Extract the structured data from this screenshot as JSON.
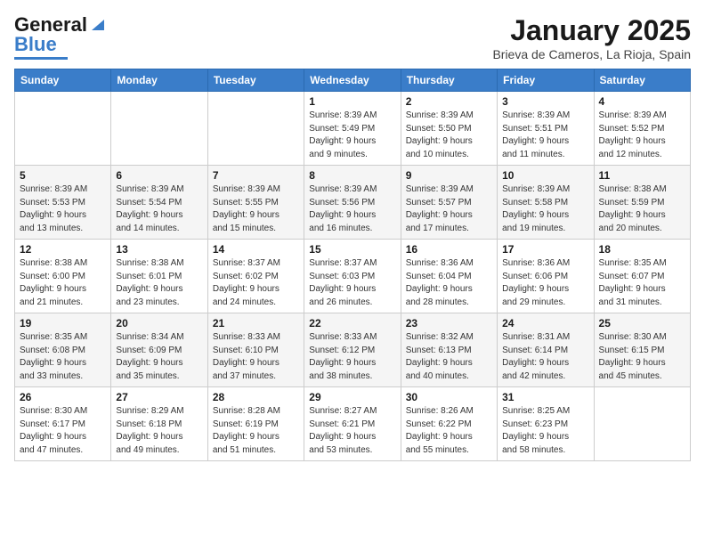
{
  "logo": {
    "line1": "General",
    "line2": "Blue"
  },
  "header": {
    "month": "January 2025",
    "location": "Brieva de Cameros, La Rioja, Spain"
  },
  "weekdays": [
    "Sunday",
    "Monday",
    "Tuesday",
    "Wednesday",
    "Thursday",
    "Friday",
    "Saturday"
  ],
  "weeks": [
    [
      {
        "day": null,
        "content": null
      },
      {
        "day": null,
        "content": null
      },
      {
        "day": null,
        "content": null
      },
      {
        "day": "1",
        "content": "Sunrise: 8:39 AM\nSunset: 5:49 PM\nDaylight: 9 hours\nand 9 minutes."
      },
      {
        "day": "2",
        "content": "Sunrise: 8:39 AM\nSunset: 5:50 PM\nDaylight: 9 hours\nand 10 minutes."
      },
      {
        "day": "3",
        "content": "Sunrise: 8:39 AM\nSunset: 5:51 PM\nDaylight: 9 hours\nand 11 minutes."
      },
      {
        "day": "4",
        "content": "Sunrise: 8:39 AM\nSunset: 5:52 PM\nDaylight: 9 hours\nand 12 minutes."
      }
    ],
    [
      {
        "day": "5",
        "content": "Sunrise: 8:39 AM\nSunset: 5:53 PM\nDaylight: 9 hours\nand 13 minutes."
      },
      {
        "day": "6",
        "content": "Sunrise: 8:39 AM\nSunset: 5:54 PM\nDaylight: 9 hours\nand 14 minutes."
      },
      {
        "day": "7",
        "content": "Sunrise: 8:39 AM\nSunset: 5:55 PM\nDaylight: 9 hours\nand 15 minutes."
      },
      {
        "day": "8",
        "content": "Sunrise: 8:39 AM\nSunset: 5:56 PM\nDaylight: 9 hours\nand 16 minutes."
      },
      {
        "day": "9",
        "content": "Sunrise: 8:39 AM\nSunset: 5:57 PM\nDaylight: 9 hours\nand 17 minutes."
      },
      {
        "day": "10",
        "content": "Sunrise: 8:39 AM\nSunset: 5:58 PM\nDaylight: 9 hours\nand 19 minutes."
      },
      {
        "day": "11",
        "content": "Sunrise: 8:38 AM\nSunset: 5:59 PM\nDaylight: 9 hours\nand 20 minutes."
      }
    ],
    [
      {
        "day": "12",
        "content": "Sunrise: 8:38 AM\nSunset: 6:00 PM\nDaylight: 9 hours\nand 21 minutes."
      },
      {
        "day": "13",
        "content": "Sunrise: 8:38 AM\nSunset: 6:01 PM\nDaylight: 9 hours\nand 23 minutes."
      },
      {
        "day": "14",
        "content": "Sunrise: 8:37 AM\nSunset: 6:02 PM\nDaylight: 9 hours\nand 24 minutes."
      },
      {
        "day": "15",
        "content": "Sunrise: 8:37 AM\nSunset: 6:03 PM\nDaylight: 9 hours\nand 26 minutes."
      },
      {
        "day": "16",
        "content": "Sunrise: 8:36 AM\nSunset: 6:04 PM\nDaylight: 9 hours\nand 28 minutes."
      },
      {
        "day": "17",
        "content": "Sunrise: 8:36 AM\nSunset: 6:06 PM\nDaylight: 9 hours\nand 29 minutes."
      },
      {
        "day": "18",
        "content": "Sunrise: 8:35 AM\nSunset: 6:07 PM\nDaylight: 9 hours\nand 31 minutes."
      }
    ],
    [
      {
        "day": "19",
        "content": "Sunrise: 8:35 AM\nSunset: 6:08 PM\nDaylight: 9 hours\nand 33 minutes."
      },
      {
        "day": "20",
        "content": "Sunrise: 8:34 AM\nSunset: 6:09 PM\nDaylight: 9 hours\nand 35 minutes."
      },
      {
        "day": "21",
        "content": "Sunrise: 8:33 AM\nSunset: 6:10 PM\nDaylight: 9 hours\nand 37 minutes."
      },
      {
        "day": "22",
        "content": "Sunrise: 8:33 AM\nSunset: 6:12 PM\nDaylight: 9 hours\nand 38 minutes."
      },
      {
        "day": "23",
        "content": "Sunrise: 8:32 AM\nSunset: 6:13 PM\nDaylight: 9 hours\nand 40 minutes."
      },
      {
        "day": "24",
        "content": "Sunrise: 8:31 AM\nSunset: 6:14 PM\nDaylight: 9 hours\nand 42 minutes."
      },
      {
        "day": "25",
        "content": "Sunrise: 8:30 AM\nSunset: 6:15 PM\nDaylight: 9 hours\nand 45 minutes."
      }
    ],
    [
      {
        "day": "26",
        "content": "Sunrise: 8:30 AM\nSunset: 6:17 PM\nDaylight: 9 hours\nand 47 minutes."
      },
      {
        "day": "27",
        "content": "Sunrise: 8:29 AM\nSunset: 6:18 PM\nDaylight: 9 hours\nand 49 minutes."
      },
      {
        "day": "28",
        "content": "Sunrise: 8:28 AM\nSunset: 6:19 PM\nDaylight: 9 hours\nand 51 minutes."
      },
      {
        "day": "29",
        "content": "Sunrise: 8:27 AM\nSunset: 6:21 PM\nDaylight: 9 hours\nand 53 minutes."
      },
      {
        "day": "30",
        "content": "Sunrise: 8:26 AM\nSunset: 6:22 PM\nDaylight: 9 hours\nand 55 minutes."
      },
      {
        "day": "31",
        "content": "Sunrise: 8:25 AM\nSunset: 6:23 PM\nDaylight: 9 hours\nand 58 minutes."
      },
      {
        "day": null,
        "content": null
      }
    ]
  ]
}
